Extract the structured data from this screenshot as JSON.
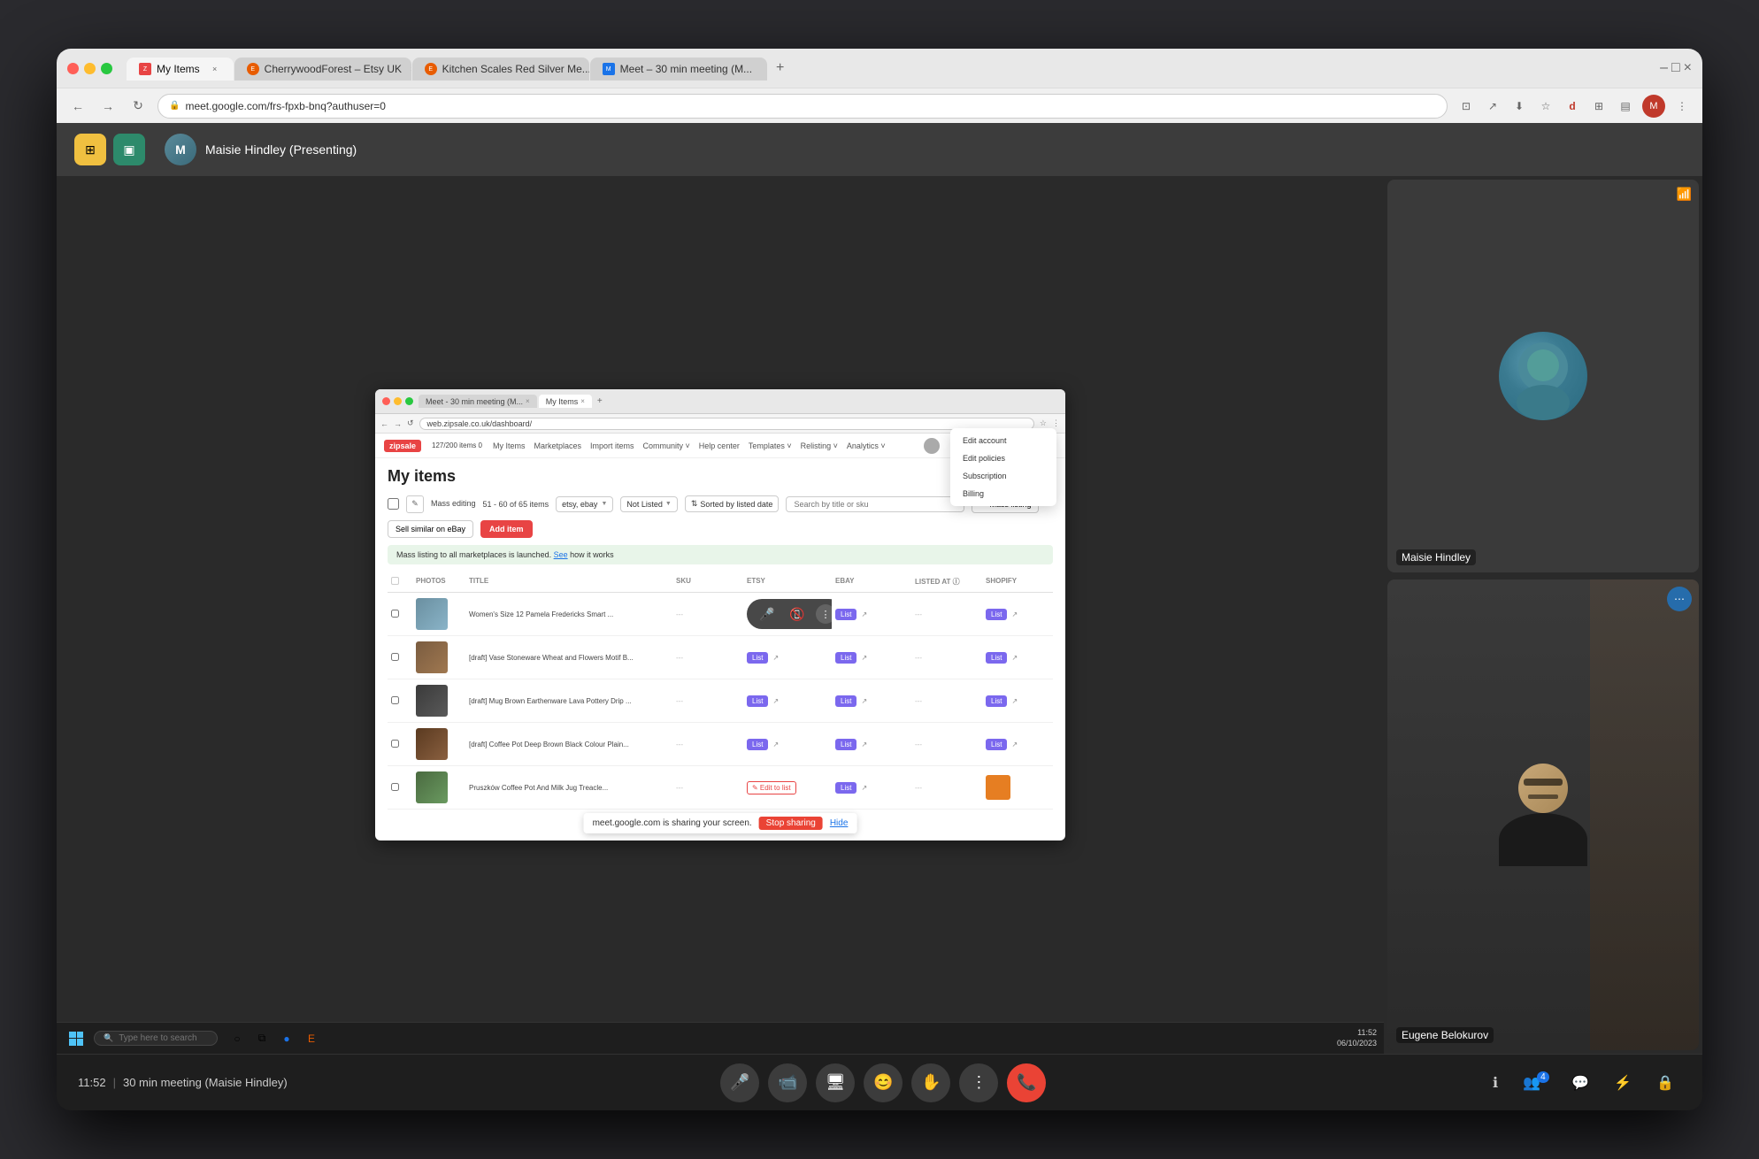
{
  "browser": {
    "tabs": [
      {
        "label": "My Items",
        "favicon_color": "#e84444",
        "active": true
      },
      {
        "label": "CherrywoodForest – Etsy UK",
        "favicon_color": "#e85c00",
        "active": false
      },
      {
        "label": "Kitchen Scales Red Silver Me...",
        "favicon_color": "#e85c00",
        "active": false
      },
      {
        "label": "Meet – 30 min meeting (M...",
        "favicon_color": "#1a73e8",
        "active": false
      }
    ],
    "url": "meet.google.com/frs-fpxb-bnq?authuser=0"
  },
  "meet": {
    "presenter": "Maisie Hindley (Presenting)",
    "time": "11:52",
    "meeting_name": "30 min meeting (Maisie Hindley)",
    "participants": [
      {
        "name": "Maisie Hindley"
      },
      {
        "name": "Eugene Belokurov"
      }
    ],
    "participant_count": 4
  },
  "zipsale": {
    "logo": "zipsale",
    "url": "web.zipsale.co.uk/dashboard/",
    "counter": "127/200 items 0",
    "nav_items": [
      "My Items",
      "Marketplaces",
      "Import items",
      "Community",
      "Help center",
      "Templates",
      "Relisting",
      "Analytics"
    ],
    "dropdown_items": [
      "Edit account",
      "Edit policies",
      "Subscription",
      "Billing"
    ]
  },
  "my_items": {
    "title": "My items",
    "pagination": "51 - 60 of 65 items",
    "filter_marketplace": "etsy, ebay",
    "filter_status": "Not Listed",
    "sort_label": "Sorted by listed date",
    "search_placeholder": "Search by title or sku",
    "mass_editing_label": "Mass editing",
    "mass_listing_label": "Mass listing",
    "sell_similar_label": "Sell similar on eBay",
    "add_item_label": "Add item",
    "info_banner": "Mass listing to all marketplaces is launched. See how it works",
    "table_headers": [
      "",
      "PHOTOS",
      "TITLE",
      "SKU",
      "ETSY",
      "EBAY",
      "LISTED AT",
      "SHOPIFY"
    ],
    "items": [
      {
        "title": "Women's Size 12 Pamela Fredericks Smart ...",
        "sku": "---",
        "etsy_listed": true,
        "ebay_listed": true,
        "listed_at": "---",
        "shopify_listed": true,
        "thumb_class": "thumb-blue"
      },
      {
        "title": "[draft] Vase Stoneware Wheat and Flowers Motif B...",
        "sku": "---",
        "etsy_listed": true,
        "ebay_listed": true,
        "listed_at": "---",
        "shopify_listed": true,
        "thumb_class": "thumb-brown"
      },
      {
        "title": "[draft] Mug Brown Earthenware Lava Pottery Drip ...",
        "sku": "---",
        "etsy_listed": true,
        "ebay_listed": true,
        "listed_at": "---",
        "shopify_listed": true,
        "thumb_class": "thumb-dark"
      },
      {
        "title": "[draft] Coffee Pot Deep Brown Black Colour Plain...",
        "sku": "---",
        "etsy_listed": true,
        "ebay_listed": true,
        "listed_at": "---",
        "shopify_listed": true,
        "thumb_class": "thumb-coffee"
      },
      {
        "title": "Pruszków Coffee Pot And Milk Jug Treacle...",
        "sku": "---",
        "etsy_edit_to_list": true,
        "ebay_listed": true,
        "listed_at": "---",
        "shopify_has_orange": true,
        "thumb_class": "thumb-green"
      }
    ]
  },
  "taskbar": {
    "search_placeholder": "Type here to search",
    "time": "11:52",
    "date": "06/10/2023"
  },
  "screen_share_notification": {
    "text": "meet.google.com is sharing your screen.",
    "stop_button": "Stop sharing",
    "hide_link": "Hide"
  }
}
